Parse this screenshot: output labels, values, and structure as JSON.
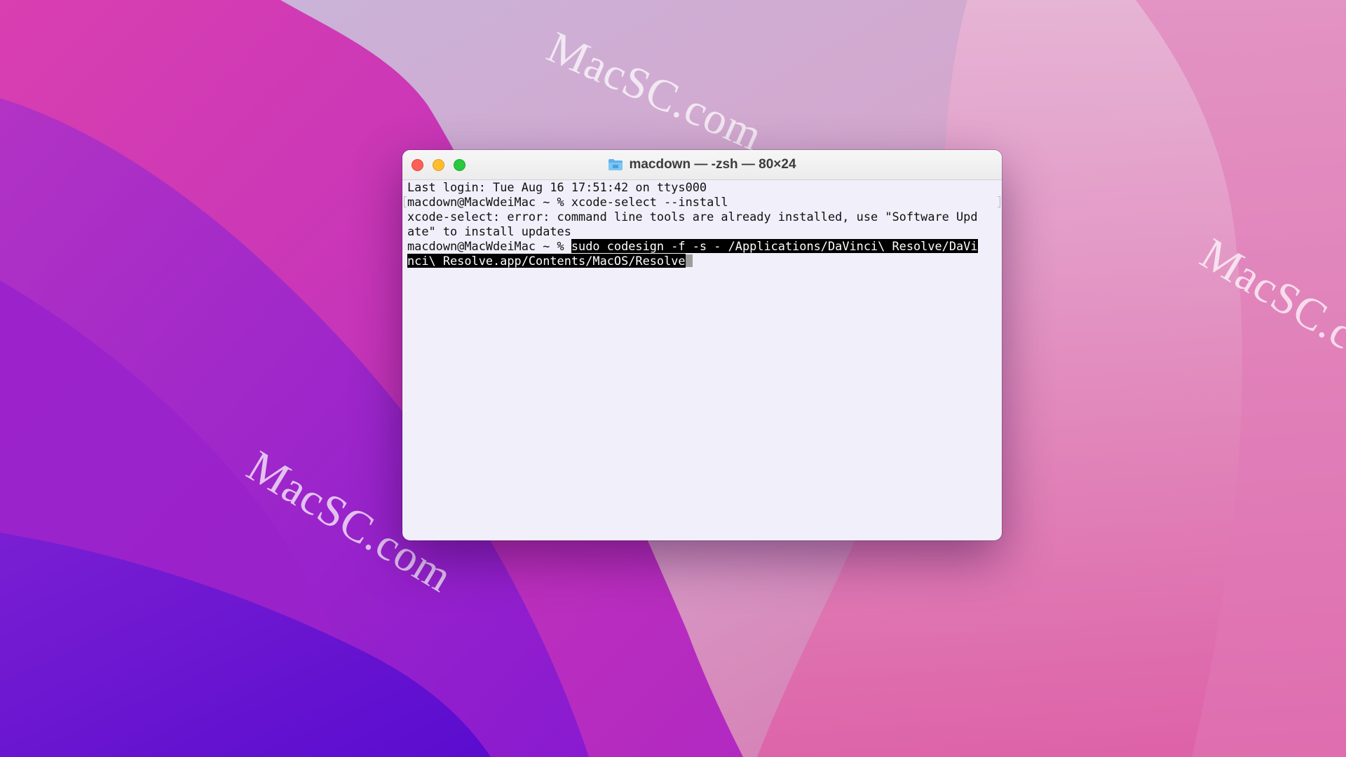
{
  "desktop": {
    "watermark": "MacSC.com"
  },
  "terminal": {
    "title": "macdown — -zsh — 80×24",
    "lines": [
      "Last login: Tue Aug 16 17:51:42 on ttys000",
      "macdown@MacWdeiMac ~ % xcode-select --install",
      "xcode-select: error: command line tools are already installed, use \"Software Upd",
      "ate\" to install updates"
    ],
    "prompt": "macdown@MacWdeiMac ~ % ",
    "command_line1": "sudo codesign -f -s - /Applications/DaVinci\\ Resolve/DaVi",
    "command_line2": "nci\\ Resolve.app/Contents/MacOS/Resolve"
  },
  "icons": {
    "close": "close-traffic-light",
    "minimize": "minimize-traffic-light",
    "zoom": "zoom-traffic-light",
    "folder": "folder-icon"
  },
  "colors": {
    "close": "#fe5f57",
    "minimize": "#febc2e",
    "zoom": "#28c840",
    "terminal_bg": "#f1eff9",
    "selection_bg": "#000000",
    "selection_fg": "#ffffff"
  }
}
